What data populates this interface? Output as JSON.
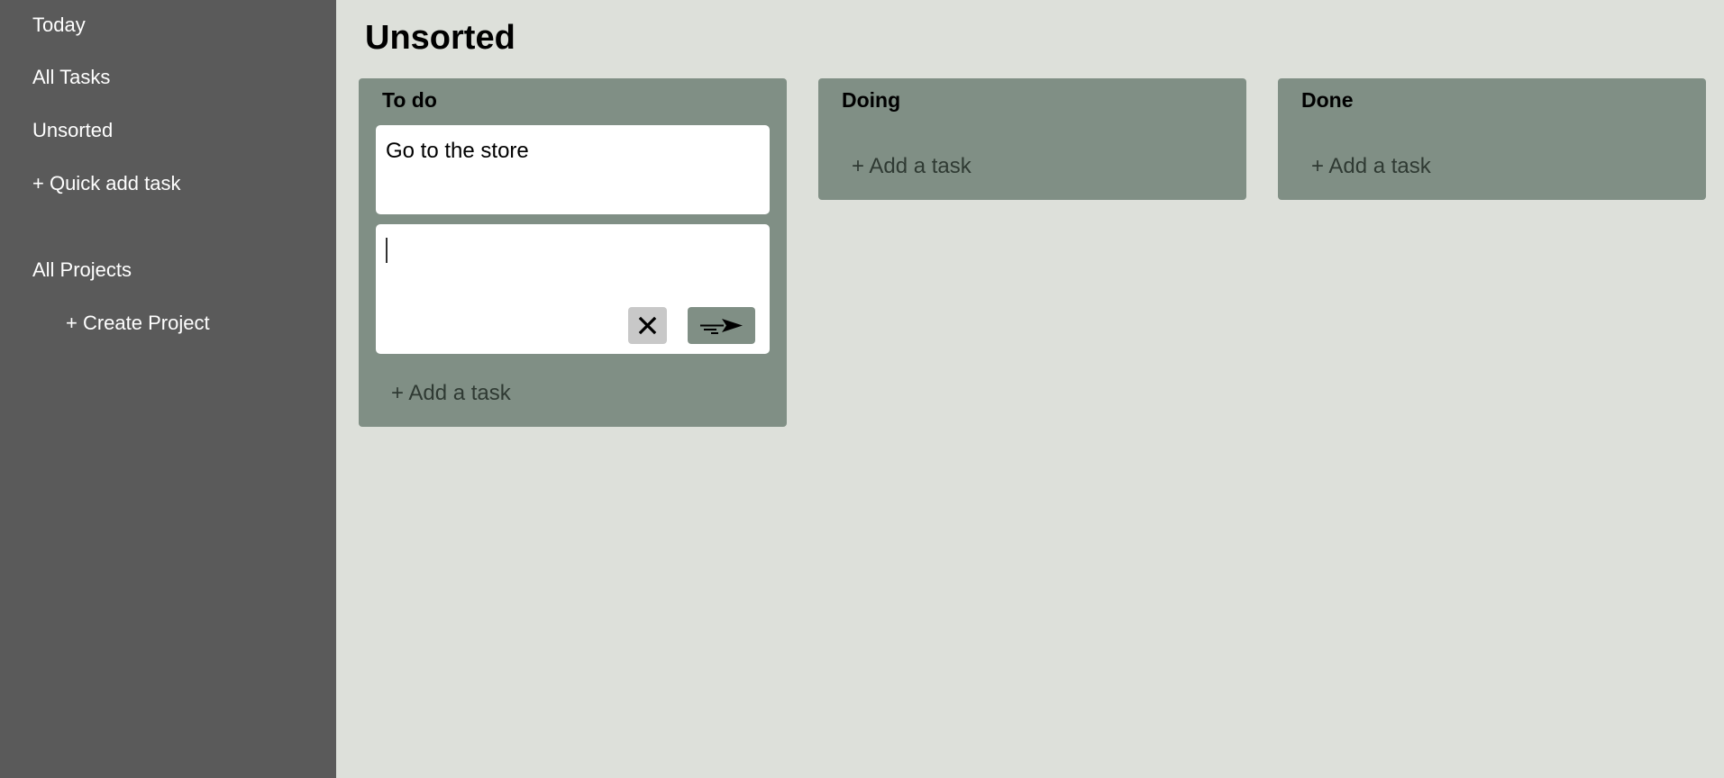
{
  "sidebar": {
    "items": [
      {
        "label": "Today"
      },
      {
        "label": "All Tasks"
      },
      {
        "label": "Unsorted"
      },
      {
        "label": "+ Quick add task"
      }
    ],
    "projects": {
      "label": "All Projects",
      "create_label": "+ Create Project"
    }
  },
  "main": {
    "title": "Unsorted",
    "columns": [
      {
        "title": "To do",
        "tasks": [
          {
            "text": "Go to the store"
          }
        ],
        "editor": {
          "value": "",
          "cancel_icon": "close-icon",
          "submit_icon": "send-arrow-icon"
        },
        "add_label": "+ Add a task"
      },
      {
        "title": "Doing",
        "tasks": [],
        "add_label": "+ Add a task"
      },
      {
        "title": "Done",
        "tasks": [],
        "add_label": "+ Add a task"
      }
    ]
  },
  "colors": {
    "sidebar_bg": "#5a5a5a",
    "page_bg": "#dde0da",
    "column_bg": "#808f85",
    "card_bg": "#ffffff",
    "cancel_bg": "#c8c8c8"
  }
}
